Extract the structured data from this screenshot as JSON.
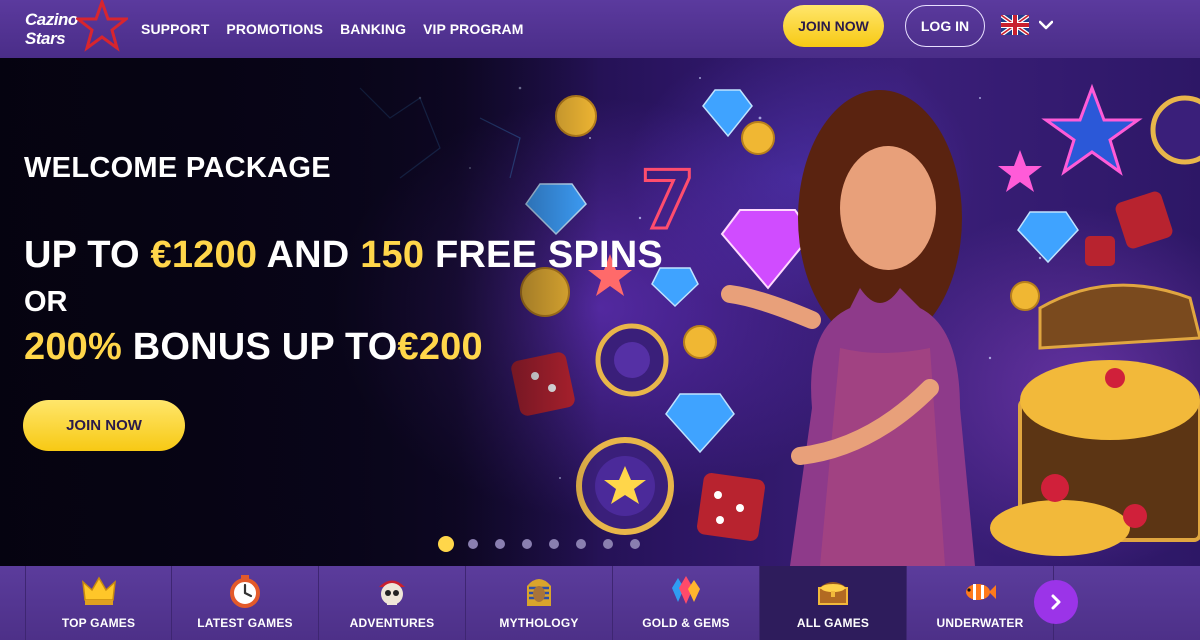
{
  "header": {
    "logo_line1": "Cazino",
    "logo_line2": "Stars",
    "nav": [
      "SUPPORT",
      "PROMOTIONS",
      "BANKING",
      "VIP PROGRAM"
    ],
    "join_label": "JOIN NOW",
    "login_label": "LOG IN",
    "language_icon": "uk-flag-icon"
  },
  "hero": {
    "subtitle": "WELCOME PACKAGE",
    "line1": {
      "a": "UP TO ",
      "b": "€1200",
      "c": " AND ",
      "d": "150",
      "e": " FREE SPINS"
    },
    "or": "OR",
    "line2": {
      "a": "200%",
      "b": " BONUS UP TO",
      "c": "€200"
    },
    "cta": "JOIN NOW",
    "slides_total": 8,
    "slide_active": 1
  },
  "categories": [
    {
      "label": "TOP GAMES",
      "icon": "crown-icon"
    },
    {
      "label": "LATEST GAMES",
      "icon": "stopwatch-icon"
    },
    {
      "label": "ADVENTURES",
      "icon": "pirate-skull-icon"
    },
    {
      "label": "MYTHOLOGY",
      "icon": "pharaoh-icon"
    },
    {
      "label": "GOLD & GEMS",
      "icon": "gems-icon"
    },
    {
      "label": "ALL GAMES",
      "icon": "treasure-chest-icon"
    },
    {
      "label": "UNDERWATER",
      "icon": "clownfish-icon"
    }
  ],
  "colors": {
    "accent_yellow": "#ffd64a",
    "header_purple": "#5b3a9e",
    "next_button": "#9b34e8"
  }
}
